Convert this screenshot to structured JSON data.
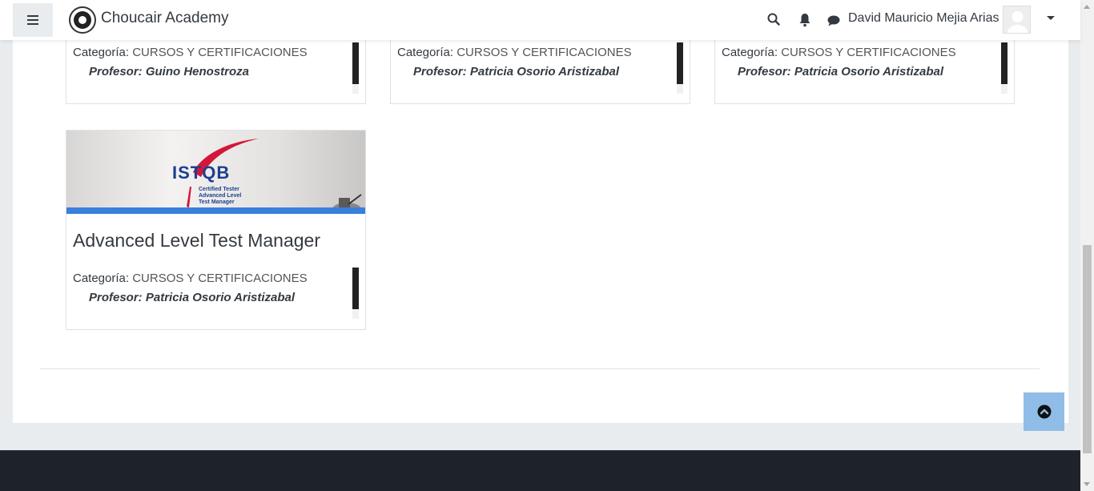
{
  "navbar": {
    "site_name": "Choucair Academy",
    "user_name": "David Mauricio Mejia Arias",
    "icons": {
      "menu": "hamburger-icon",
      "search": "search-icon",
      "notifications": "bell-icon",
      "messages": "chat-icon",
      "user_menu": "chevron-down-icon"
    }
  },
  "courses_top": [
    {
      "category_label": "Categoría:",
      "category": "CURSOS Y CERTIFICACIONES",
      "teacher": "Profesor: Guino Henostroza"
    },
    {
      "category_label": "Categoría:",
      "category": "CURSOS Y CERTIFICACIONES",
      "teacher": "Profesor: Patricia Osorio Aristizabal"
    },
    {
      "category_label": "Categoría:",
      "category": "CURSOS Y CERTIFICACIONES",
      "teacher": "Profesor: Patricia Osorio Aristizabal"
    }
  ],
  "course_featured": {
    "image_logo_text": "ISTQB",
    "image_sub_text": [
      "Certified Tester",
      "Advanced Level",
      "Test Manager"
    ],
    "title": "Advanced Level Test Manager",
    "category_label": "Categoría:",
    "category": "CURSOS Y CERTIFICACIONES",
    "teacher": "Profesor: Patricia Osorio Aristizabal"
  },
  "back_to_top_icon": "chevron-up-circle-icon",
  "colors": {
    "accent_bar": "#3a7fd9",
    "back_to_top": "#8fbde8",
    "footer": "#1e232b"
  }
}
